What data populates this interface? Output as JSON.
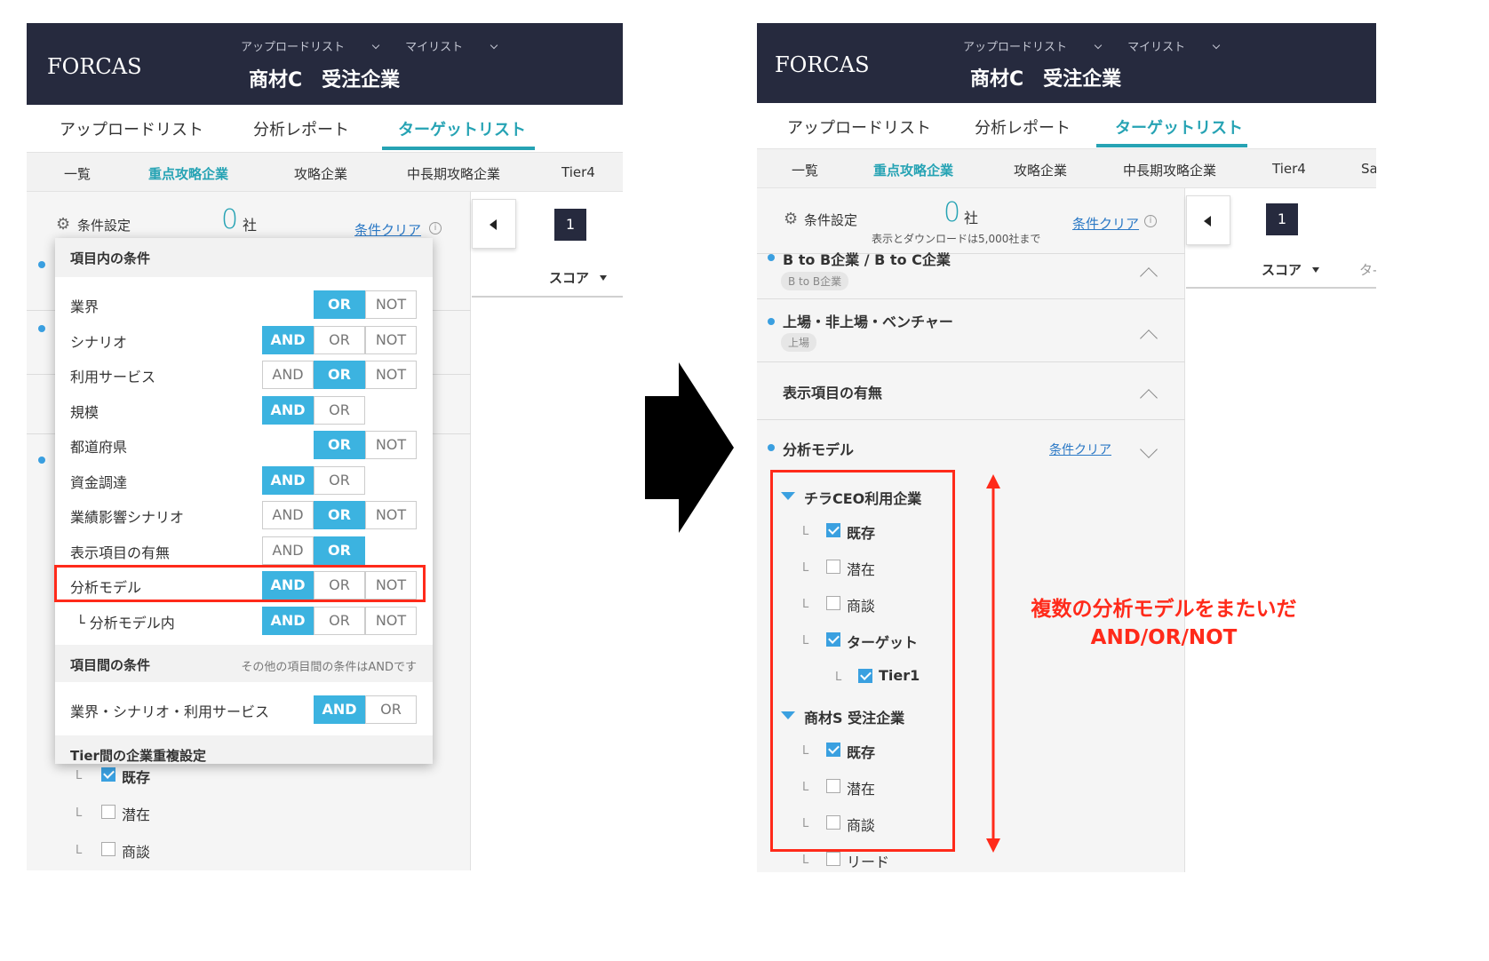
{
  "left": {
    "logo": "FORCAS",
    "header_menu": [
      "アップロードリスト",
      "マイリスト"
    ],
    "header_title": "商材C　受注企業",
    "main_tabs": [
      "アップロードリスト",
      "分析レポート",
      "ターゲットリスト"
    ],
    "sub_tabs": [
      "一覧",
      "重点攻略企業",
      "攻略企業",
      "中長期攻略企業",
      "Tier4"
    ],
    "cond_label": "条件設定",
    "count": "0",
    "count_unit": "社",
    "clear_label": "条件クリア",
    "page": "1",
    "score_label": "スコア",
    "popup": {
      "section1": "項目内の条件",
      "rows": [
        {
          "label": "業界",
          "buttons": [
            "OR",
            "NOT"
          ],
          "active": "OR"
        },
        {
          "label": "シナリオ",
          "buttons": [
            "AND",
            "OR",
            "NOT"
          ],
          "active": "AND"
        },
        {
          "label": "利用サービス",
          "buttons": [
            "AND",
            "OR",
            "NOT"
          ],
          "active": "OR"
        },
        {
          "label": "規模",
          "buttons": [
            "AND",
            "OR"
          ],
          "active": "AND"
        },
        {
          "label": "都道府県",
          "buttons": [
            "OR",
            "NOT"
          ],
          "active": "OR"
        },
        {
          "label": "資金調達",
          "buttons": [
            "AND",
            "OR"
          ],
          "active": "AND"
        },
        {
          "label": "業績影響シナリオ",
          "buttons": [
            "AND",
            "OR",
            "NOT"
          ],
          "active": "OR"
        },
        {
          "label": "表示項目の有無",
          "buttons": [
            "AND",
            "OR"
          ],
          "active": "OR"
        },
        {
          "label": "分析モデル",
          "buttons": [
            "AND",
            "OR",
            "NOT"
          ],
          "active": "AND"
        },
        {
          "label": "└ 分析モデル内",
          "buttons": [
            "AND",
            "OR",
            "NOT"
          ],
          "active": "AND"
        }
      ],
      "section2": "項目間の条件",
      "section2_note": "その他の項目間の条件はANDです",
      "inter_row": {
        "label": "業界・シナリオ・利用サービス",
        "buttons": [
          "AND",
          "OR"
        ],
        "active": "AND"
      },
      "section3": "Tier間の企業重複設定"
    },
    "below_items": [
      {
        "label": "既存",
        "checked": true
      },
      {
        "label": "潜在",
        "checked": false
      },
      {
        "label": "商談",
        "checked": false
      }
    ]
  },
  "right": {
    "logo": "FORCAS",
    "header_menu": [
      "アップロードリスト",
      "マイリスト"
    ],
    "header_title": "商材C　受注企業",
    "main_tabs": [
      "アップロードリスト",
      "分析レポート",
      "ターゲットリスト"
    ],
    "sub_tabs": [
      "一覧",
      "重点攻略企業",
      "攻略企業",
      "中長期攻略企業",
      "Tier4",
      "Sa"
    ],
    "cond_label": "条件設定",
    "count": "0",
    "count_unit": "社",
    "count_note": "表示とダウンロードは5,000社まで",
    "clear_label": "条件クリア",
    "page": "1",
    "score_label": "スコア",
    "score_next": "タ-",
    "rows": [
      {
        "title": "B to B企業 / B to C企業",
        "pill": "B to B企業"
      },
      {
        "title": "上場・非上場・ベンチャー",
        "pill": "上場"
      },
      {
        "title": "表示項目の有無"
      }
    ],
    "model_title": "分析モデル",
    "model_clear": "条件クリア",
    "groups": [
      {
        "name": "チラCEO利用企業",
        "items": [
          {
            "label": "既存",
            "checked": true
          },
          {
            "label": "潜在",
            "checked": false
          },
          {
            "label": "商談",
            "checked": false
          },
          {
            "label": "ターゲット",
            "checked": true
          },
          {
            "label": "Tier1",
            "checked": true
          }
        ]
      },
      {
        "name": "商材S 受注企業",
        "items": [
          {
            "label": "既存",
            "checked": true
          },
          {
            "label": "潜在",
            "checked": false
          },
          {
            "label": "商談",
            "checked": false
          },
          {
            "label": "リード",
            "checked": false
          }
        ]
      }
    ]
  },
  "annotation": {
    "line1": "複数の分析モデルをまたいだ",
    "line2": "AND/OR/NOT"
  },
  "colors": {
    "header_bg": "#262a3e",
    "accent": "#26a3b4",
    "button_on": "#3cb3e0",
    "highlight": "#ff2a1a"
  }
}
